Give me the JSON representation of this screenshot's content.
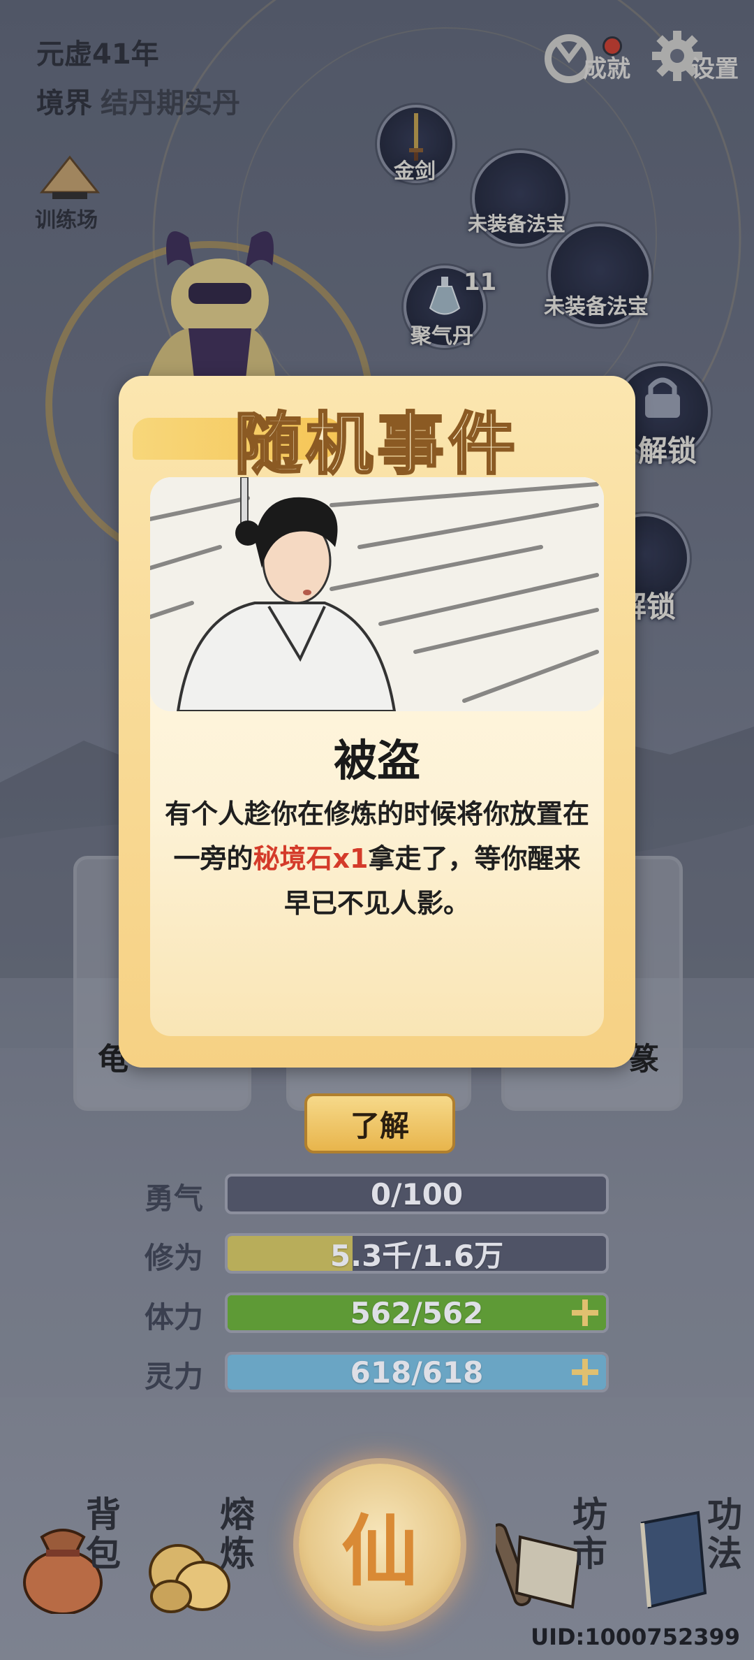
{
  "header": {
    "year": "元虚41年",
    "realm_label": "境界",
    "realm_value": "结丹期实丹"
  },
  "top_buttons": {
    "achievements": "成就",
    "settings": "设置"
  },
  "left_menu": {
    "training": "训练场"
  },
  "equipment": {
    "slots": [
      {
        "label": "金剑"
      },
      {
        "label": "未装备法宝"
      },
      {
        "label": "未装备法宝"
      },
      {
        "label": "聚气丹",
        "count": "11"
      },
      {
        "label": "解锁"
      },
      {
        "label": "解锁"
      }
    ]
  },
  "behind_cards": {
    "left_partial": "龟",
    "right_partial": "篆"
  },
  "modal": {
    "title": "随机事件",
    "event_name": "被盗",
    "desc_part1": "有个人趁你在修炼的时候将你放置在一旁的",
    "desc_highlight": "秘境石x1",
    "desc_part2": "拿走了，等你醒来早已不见人影。",
    "confirm_label": "了解"
  },
  "stats": [
    {
      "label": "勇气",
      "value": "0/100",
      "fraction": 0.0,
      "color": "#4f5366",
      "plus": false
    },
    {
      "label": "修为",
      "value": "5.3千/1.6万",
      "fraction": 0.33,
      "color": "#b8ad5a",
      "plus": false
    },
    {
      "label": "体力",
      "value": "562/562",
      "fraction": 1.0,
      "color": "#5e9a36",
      "plus": true
    },
    {
      "label": "灵力",
      "value": "618/618",
      "fraction": 1.0,
      "color": "#6aa5c4",
      "plus": true
    }
  ],
  "bottom_nav": {
    "bag": "背包",
    "smelt": "熔炼",
    "center": "仙",
    "market": "坊市",
    "skills": "功法"
  },
  "uid": "UID:1000752399",
  "colors": {
    "accent_gold": "#e8b54c",
    "highlight_red": "#d43b2a",
    "slot_dark": "#1e2336"
  },
  "icons": {
    "achievements": "medal-icon",
    "settings": "gear-icon",
    "training": "straw-hat-icon",
    "sword": "sword-icon",
    "potion": "vase-icon",
    "lock": "lock-icon",
    "bag": "pouch-icon",
    "smelt": "stones-icon",
    "market": "scroll-icon",
    "skills": "book-icon"
  }
}
